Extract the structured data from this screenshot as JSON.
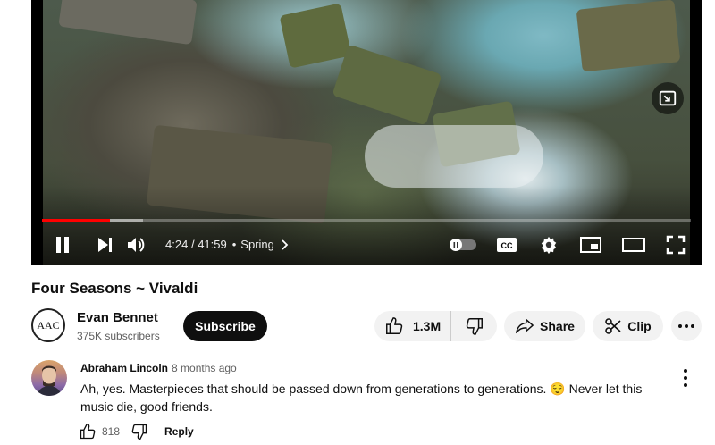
{
  "player": {
    "current_time": "4:24",
    "duration": "41:59",
    "separator": "/",
    "chapter_dot": "•",
    "chapter": "Spring",
    "progress_fraction": 0.105,
    "buffered_fraction": 0.155,
    "cc_label": "CC",
    "icons": [
      "pause-icon",
      "next-icon",
      "volume-icon",
      "autoplay-toggle",
      "captions-icon",
      "settings-gear-icon",
      "miniplayer-icon",
      "theater-mode-icon",
      "fullscreen-icon",
      "picture-in-picture-icon"
    ],
    "colors": {
      "progress": "#ff0000"
    }
  },
  "video": {
    "title": "Four Seasons ~ Vivaldi"
  },
  "channel": {
    "avatar_text": "AAC",
    "name": "Evan Bennet",
    "subscribers": "375K subscribers",
    "subscribe_label": "Subscribe"
  },
  "actions": {
    "likes": "1.3M",
    "share_label": "Share",
    "clip_label": "Clip"
  },
  "comment": {
    "author": "Abraham Lincoln",
    "time": "8 months ago",
    "text": "Ah, yes. Masterpieces that should be passed down from generations to generations. 😌 Never let this music die, good friends.",
    "likes": "818",
    "reply_label": "Reply"
  }
}
